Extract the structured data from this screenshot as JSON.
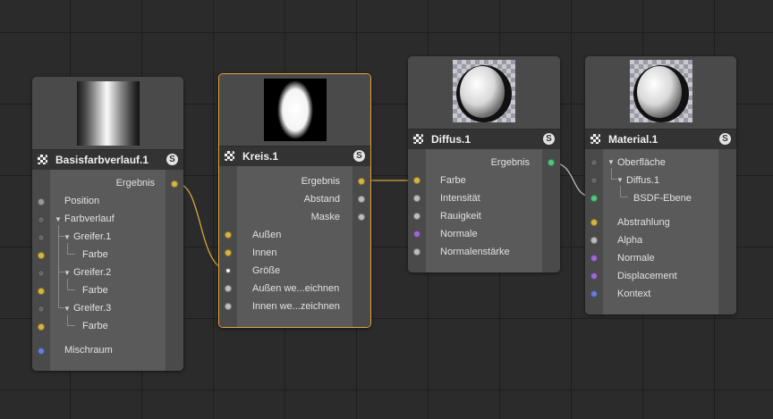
{
  "nodes": {
    "basis": {
      "title": "Basisfarbverlauf.1",
      "output": "Ergebnis",
      "inputs": [
        "Position",
        "Farbverlauf",
        "Greifer.1",
        "Farbe",
        "Greifer.2",
        "Farbe",
        "Greifer.3",
        "Farbe",
        "Mischraum"
      ]
    },
    "kreis": {
      "title": "Kreis.1",
      "outputs": [
        "Ergebnis",
        "Abstand",
        "Maske"
      ],
      "inputs": [
        "Außen",
        "Innen",
        "Größe",
        "Außen we...eichnen",
        "Innen we...zeichnen"
      ]
    },
    "diffus": {
      "title": "Diffus.1",
      "output": "Ergebnis",
      "inputs": [
        "Farbe",
        "Intensität",
        "Rauigkeit",
        "Normale",
        "Normalenstärke"
      ]
    },
    "material": {
      "title": "Material.1",
      "inputs": [
        "Oberfläche",
        "Diffus.1",
        "BSDF-Ebene",
        "Abstrahlung",
        "Alpha",
        "Normale",
        "Displacement",
        "Kontext"
      ]
    }
  },
  "badge": "S",
  "colors": {
    "selected_border": "#e6a53d",
    "wire": "#d5a53f",
    "yellow_port": "#d5b542",
    "green_port": "#55c57a",
    "purple_port": "#9d6bd0",
    "blue_port": "#6a7dd6"
  }
}
